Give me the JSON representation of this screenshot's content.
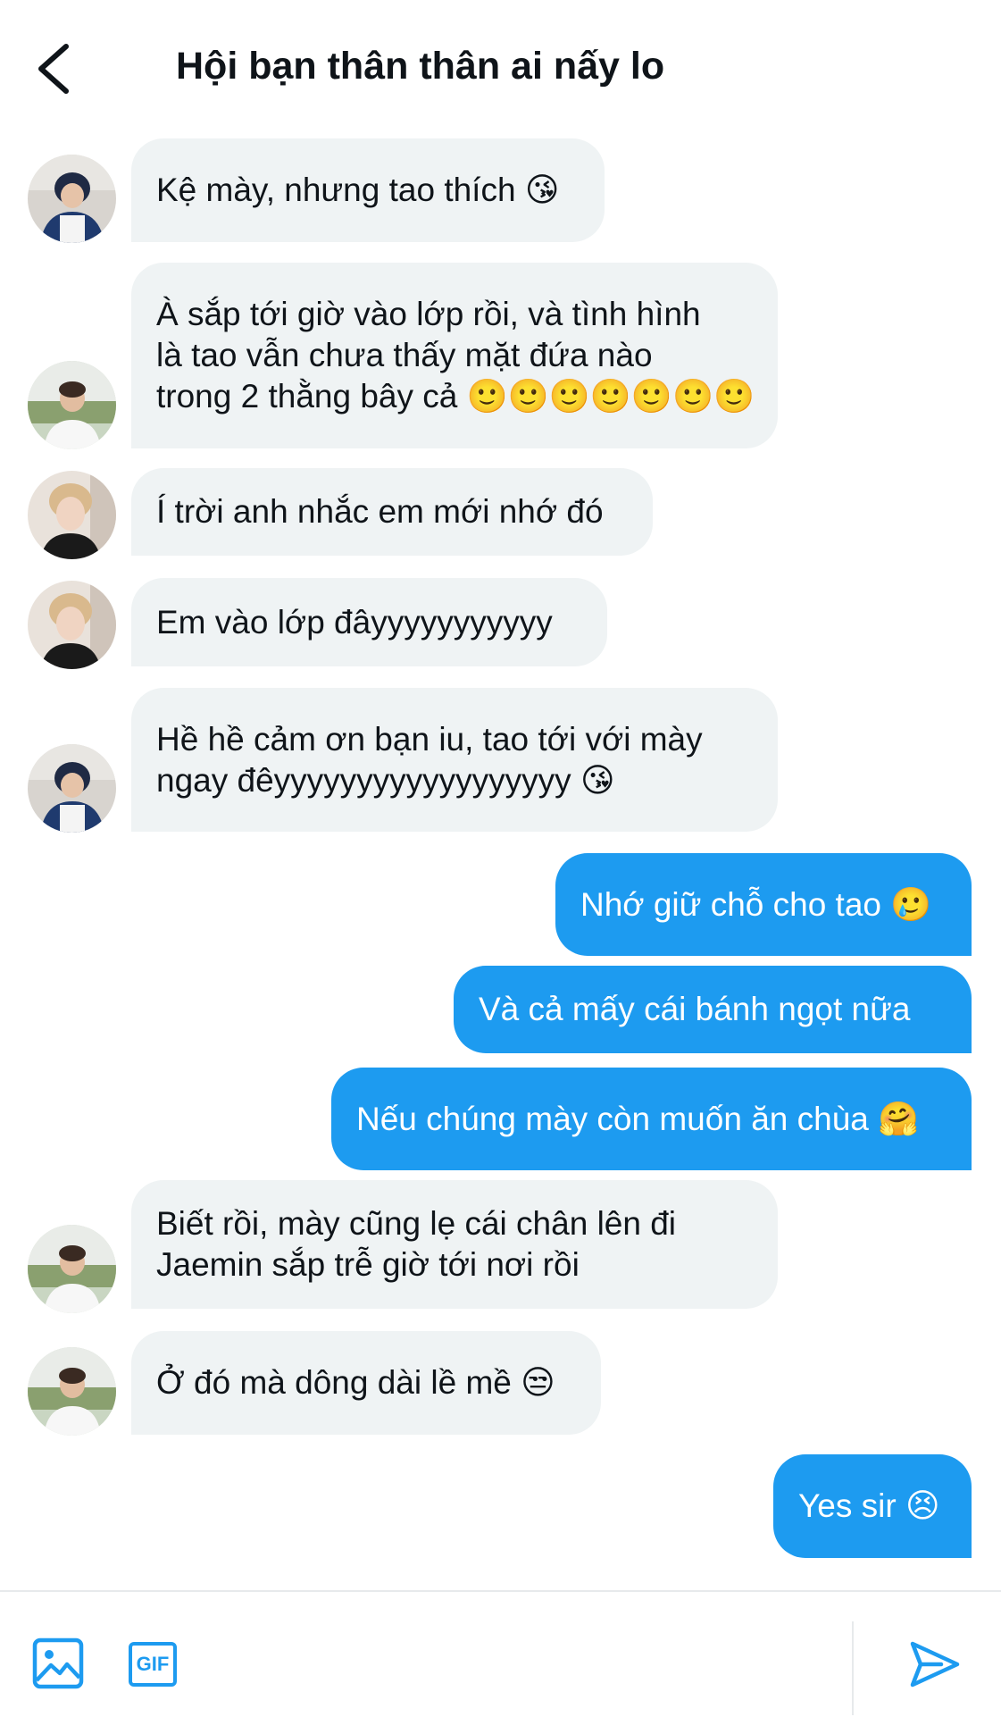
{
  "header": {
    "title": "Hội bạn thân thân ai nấy lo"
  },
  "colors": {
    "accent": "#1d9bf0",
    "incoming_bubble": "#eff3f4",
    "text": "#0f1419"
  },
  "messages": [
    {
      "direction": "in",
      "avatar": "avatar-a",
      "lines": [
        "Kệ mày, nhưng tao thích 😘"
      ]
    },
    {
      "direction": "in",
      "avatar": "avatar-b",
      "lines": [
        "À sắp tới giờ vào lớp rồi, và tình hình",
        "là tao vẫn chưa thấy mặt đứa nào",
        "trong 2 thằng bây cả 🙂🙂🙂🙂🙂🙂🙂"
      ]
    },
    {
      "direction": "in",
      "avatar": "avatar-c",
      "lines": [
        "Í trời anh nhắc em mới nhớ đó"
      ]
    },
    {
      "direction": "in",
      "avatar": "avatar-c",
      "lines": [
        "Em vào lớp đâyyyyyyyyyyy"
      ]
    },
    {
      "direction": "in",
      "avatar": "avatar-a",
      "lines": [
        "Hề hề cảm ơn bạn iu, tao tới với mày",
        "ngay đêyyyyyyyyyyyyyyyyyy 😘"
      ]
    },
    {
      "direction": "out",
      "lines": [
        "Nhớ giữ chỗ cho tao 🥲"
      ]
    },
    {
      "direction": "out",
      "lines": [
        "Và cả mấy cái bánh ngọt nữa"
      ]
    },
    {
      "direction": "out",
      "lines": [
        "Nếu chúng mày còn muốn ăn chùa 🤗"
      ]
    },
    {
      "direction": "in",
      "avatar": "avatar-b",
      "lines": [
        "Biết rồi, mày cũng lẹ cái chân lên đi",
        "Jaemin sắp trễ giờ tới nơi rồi"
      ]
    },
    {
      "direction": "in",
      "avatar": "avatar-b",
      "lines": [
        "Ở đó mà dông dài lề mề 😒"
      ]
    },
    {
      "direction": "out",
      "lines": [
        "Yes sir 😣"
      ]
    }
  ],
  "composer": {
    "image_icon": "image-icon",
    "gif_label": "GIF",
    "send_icon": "send-icon"
  }
}
